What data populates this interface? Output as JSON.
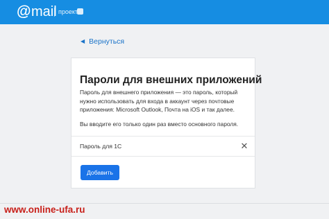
{
  "header": {
    "logo_at": "@",
    "logo_word": "mail",
    "project_label": "проект",
    "project_icon": "grid-badge-icon"
  },
  "back": {
    "arrow_icon": "back-arrow-icon",
    "label": "Вернуться"
  },
  "card": {
    "title": "Пароли для внешних приложений",
    "description": "Пароль для внешнего приложения — это пароль, который нужно использовать для входа в аккаунт через почтовые приложения: Microsoft Outlook, Почта на iOS и так далее.",
    "note": "Вы вводите его только один раз вместо основного пароля."
  },
  "passwords": [
    {
      "name": "Пароль для 1С",
      "delete_icon": "close-icon"
    }
  ],
  "actions": {
    "add_label": "Добавить"
  },
  "watermark": {
    "text": "www.online-ufa.ru"
  },
  "colors": {
    "header_bg": "#168de2",
    "accent": "#1a73e8",
    "link": "#1a73c8",
    "watermark": "#c8201a"
  }
}
